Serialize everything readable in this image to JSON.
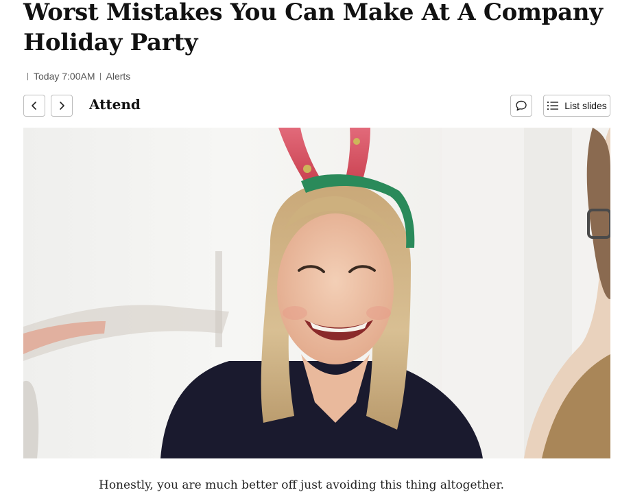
{
  "article": {
    "headline": "Worst Mistakes You Can Make At A Company Holiday Party",
    "meta": {
      "time": "Today 7:00AM",
      "alerts_label": "Alerts"
    }
  },
  "slideshow": {
    "title": "Attend",
    "list_slides_label": "List slides",
    "image_alt": "Smiling woman wearing red reindeer antler headband at office party",
    "caption": "Honestly, you are much better off just avoiding this thing altogether."
  },
  "icons": {
    "prev": "chevron-left-icon",
    "next": "chevron-right-icon",
    "comment": "speech-bubble-icon",
    "list": "list-icon"
  },
  "colors": {
    "border": "#bdbdbd",
    "text": "#111111",
    "meta_text": "#555555"
  }
}
